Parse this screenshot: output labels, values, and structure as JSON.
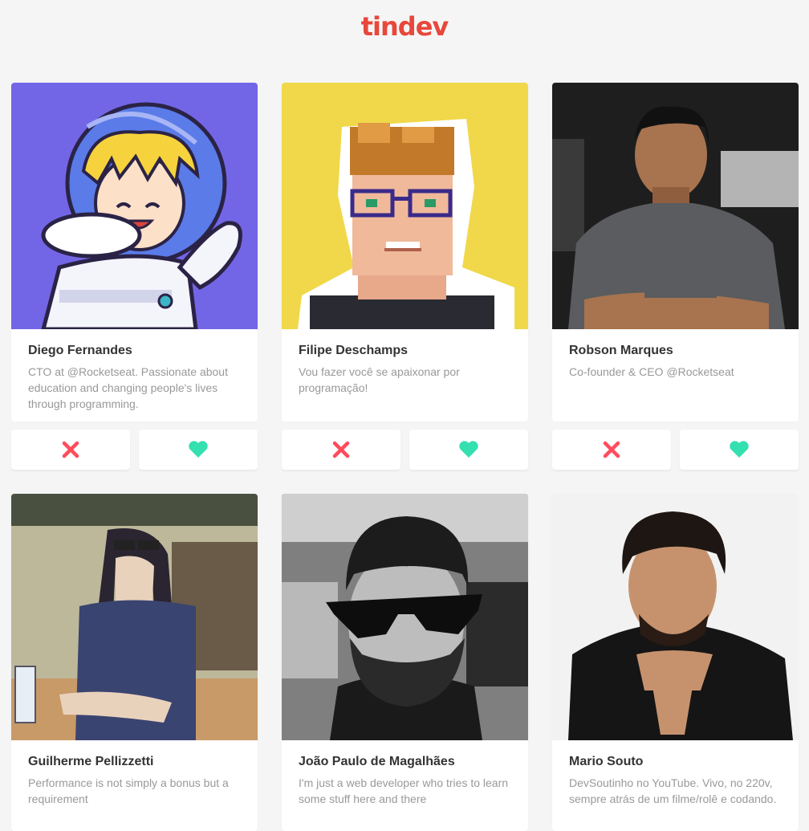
{
  "app": {
    "logo_text": "tindev",
    "brand_color": "#e8473b",
    "dislike_color": "#ff4c5c",
    "like_color": "#35e0b0"
  },
  "icons": {
    "dislike": "x-icon",
    "like": "heart-icon"
  },
  "devs": [
    {
      "name": "Diego Fernandes",
      "bio": "CTO at @Rocketseat. Passionate about education and changing people's lives through programming.",
      "avatar_bg": "#7366e6"
    },
    {
      "name": "Filipe Deschamps",
      "bio": "Vou fazer você se apaixonar por programação!",
      "avatar_bg": "#f0d84a"
    },
    {
      "name": "Robson Marques",
      "bio": "Co-founder & CEO @Rocketseat",
      "avatar_bg": "#222222"
    },
    {
      "name": "Guilherme Pellizzetti",
      "bio": "Performance is not simply a bonus but a requirement",
      "avatar_bg": "#8a9a7a"
    },
    {
      "name": "João Paulo de Magalhães",
      "bio": "I'm just a web developer who tries to learn some stuff here and there",
      "avatar_bg": "#9a9a9a"
    },
    {
      "name": "Mario Souto",
      "bio": "DevSoutinho no YouTube. Vivo, no 220v, sempre atrás de um filme/rolê e codando.",
      "avatar_bg": "#f0f0f0"
    }
  ]
}
